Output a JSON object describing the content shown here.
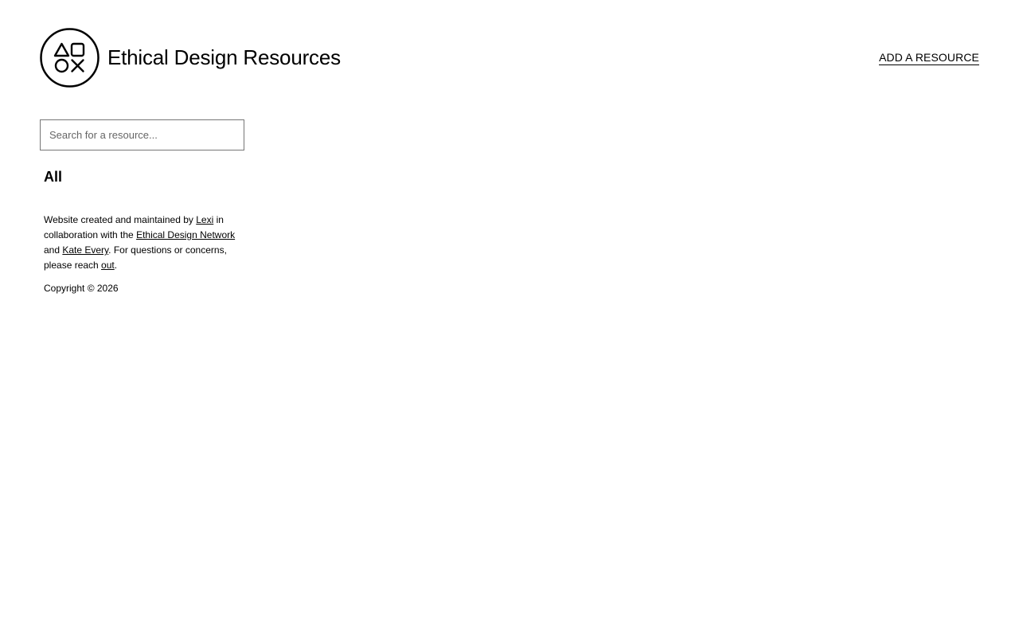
{
  "header": {
    "logo_icon": "shapes-logo-icon",
    "title": "Ethical Design Resources",
    "add_resource_label": "ADD A RESOURCE"
  },
  "sidebar": {
    "search": {
      "placeholder": "Search for a resource...",
      "value": ""
    },
    "filter_all_label": "All"
  },
  "footer": {
    "text_1": "Website created and maintained by ",
    "link_lexi": "Lexi",
    "text_2": " in collaboration with the ",
    "link_network": "Ethical Design Network",
    "text_3": " and ",
    "link_kate": "Kate Every",
    "text_4": ". For questions or concerns, please reach ",
    "link_out": "out",
    "text_5": ".",
    "copyright": "Copyright © 2026"
  },
  "colors": {
    "text": "#000000",
    "background": "#ffffff",
    "input_border": "#767676"
  }
}
